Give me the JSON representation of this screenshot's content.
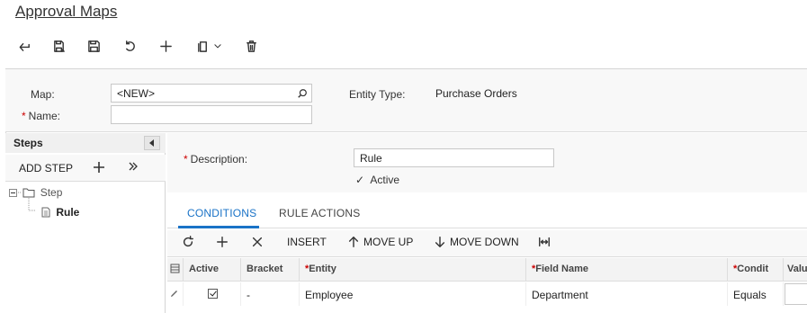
{
  "page": {
    "title": "Approval Maps"
  },
  "toolbar": {
    "buttons": [
      {
        "icon": "back-icon"
      },
      {
        "icon": "save-close-icon"
      },
      {
        "icon": "save-icon"
      },
      {
        "icon": "undo-icon"
      },
      {
        "icon": "add-icon"
      },
      {
        "icon": "copy-paste-icon"
      },
      {
        "icon": "delete-icon"
      }
    ]
  },
  "header": {
    "map_label": "Map:",
    "map_value": "<NEW>",
    "name_label": "Name:",
    "name_required": "*",
    "name_value": "",
    "entity_type_label": "Entity Type:",
    "entity_type_value": "Purchase Orders"
  },
  "steps_panel": {
    "title": "Steps",
    "add_step_label": "ADD STEP",
    "tree": {
      "step_label": "Step",
      "rule_label": "Rule"
    }
  },
  "rule_detail": {
    "description_label": "Description:",
    "description_required": "*",
    "description_value": "Rule",
    "active_label": "Active",
    "active_check": "✓"
  },
  "tabs": [
    {
      "label": "CONDITIONS",
      "active": true
    },
    {
      "label": "RULE ACTIONS",
      "active": false
    }
  ],
  "grid_toolbar": {
    "insert_label": "INSERT",
    "move_up_label": "MOVE UP",
    "move_down_label": "MOVE DOWN"
  },
  "grid": {
    "columns": [
      {
        "label": "Active",
        "required": ""
      },
      {
        "label": "Bracket",
        "required": ""
      },
      {
        "label": "Entity",
        "required": "*"
      },
      {
        "label": "Field Name",
        "required": "*"
      },
      {
        "label": "Condit",
        "required": "*"
      },
      {
        "label": "Valu",
        "required": ""
      }
    ],
    "rows": [
      {
        "active": true,
        "bracket": "-",
        "entity": "Employee",
        "field_name": "Department",
        "condition": "Equals",
        "value": ""
      }
    ]
  },
  "colors": {
    "accent": "#1a73c7",
    "required": "#cc0000"
  }
}
